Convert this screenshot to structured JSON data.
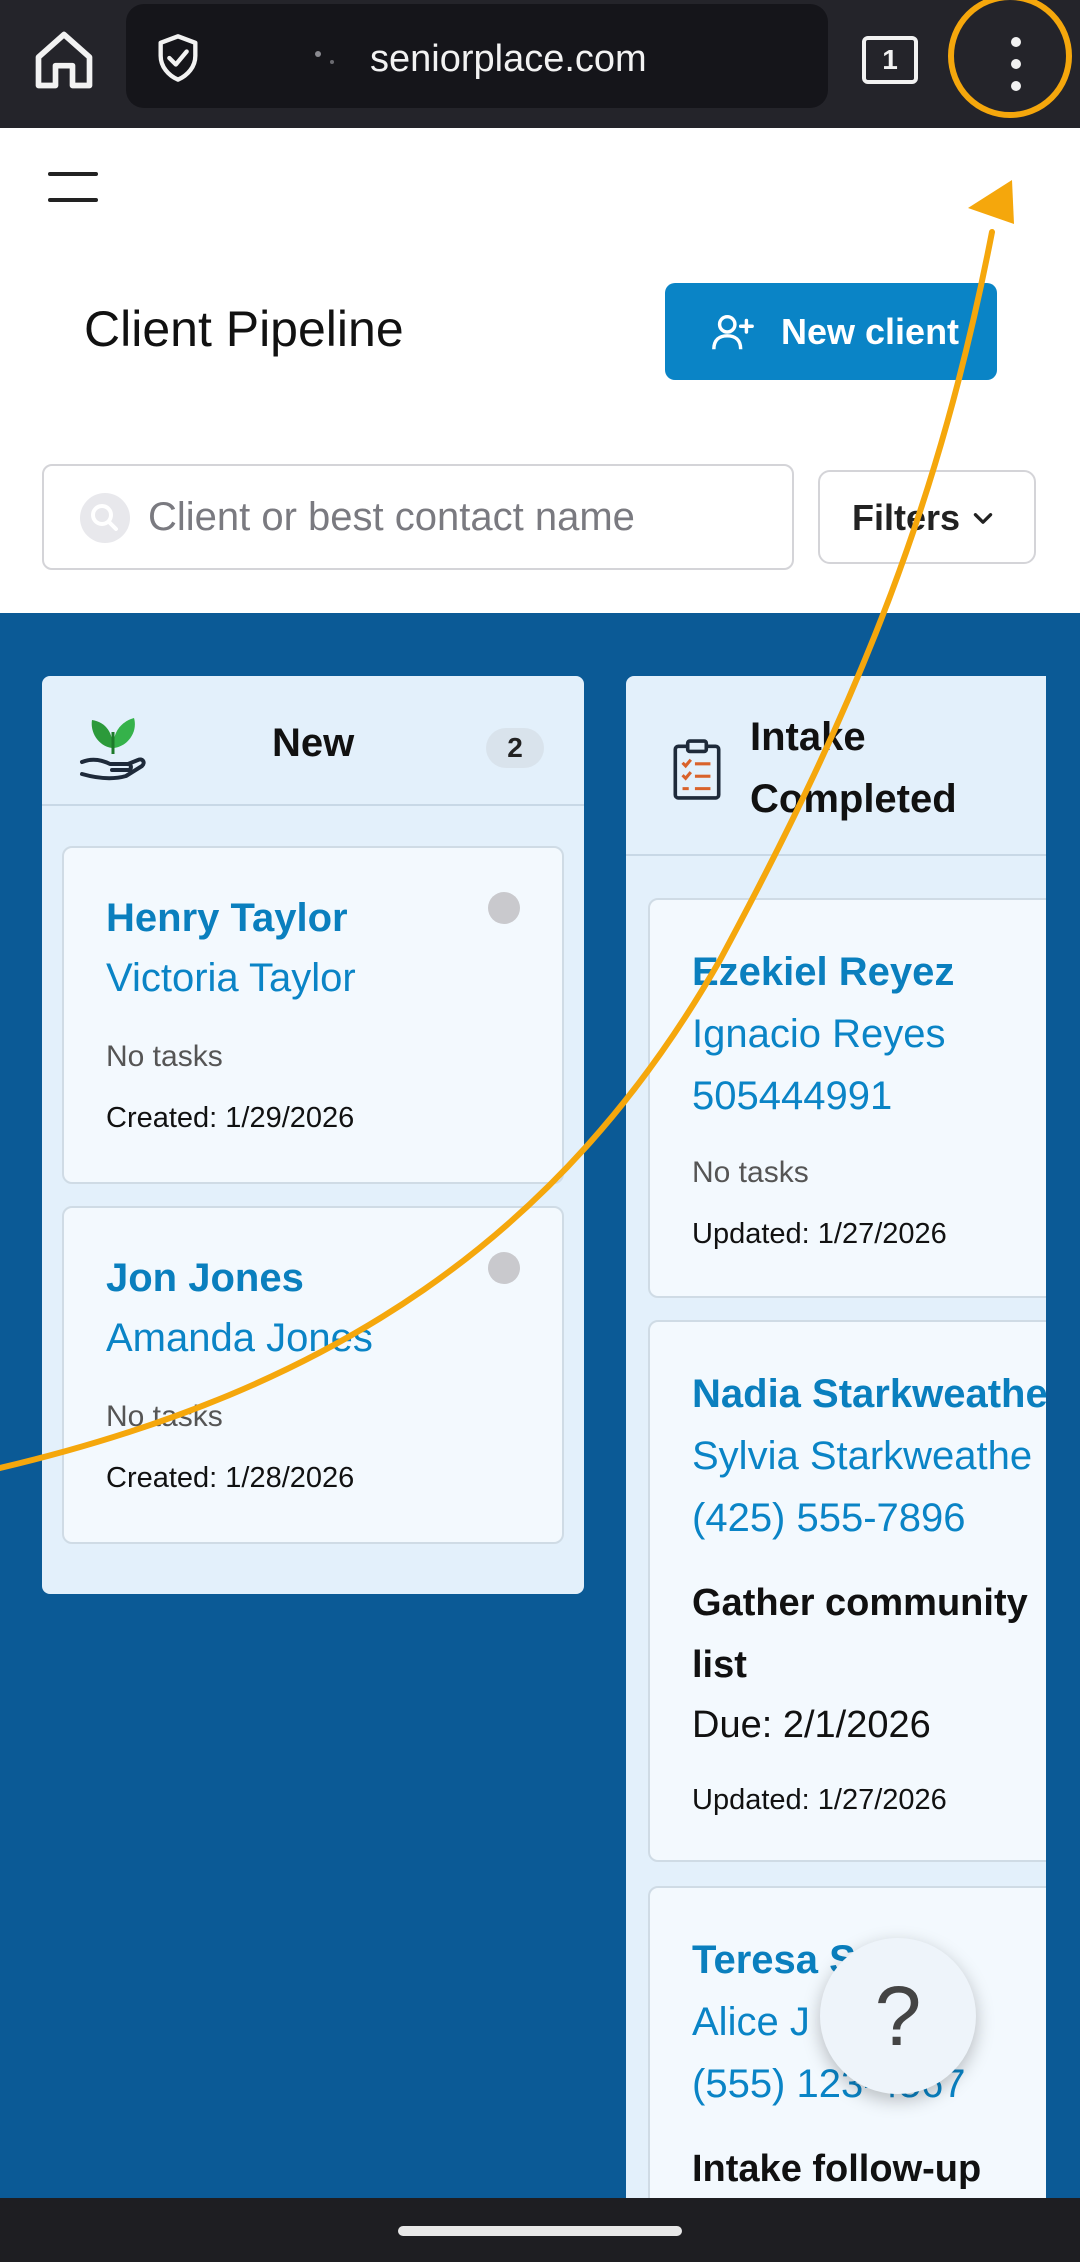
{
  "browser": {
    "url": "seniorplace.com",
    "tab_count": "1"
  },
  "header": {
    "title": "Client Pipeline",
    "new_client_label": "New client",
    "search_placeholder": "Client or best contact name",
    "filters_label": "Filters"
  },
  "columns": [
    {
      "title": "New",
      "count": "2",
      "cards": [
        {
          "name": "Henry Taylor",
          "contact": "Victoria Taylor",
          "tasks": "No tasks",
          "stamp": "Created: 1/29/2026"
        },
        {
          "name": "Jon Jones",
          "contact": "Amanda Jones",
          "tasks": "No tasks",
          "stamp": "Created: 1/28/2026"
        }
      ]
    },
    {
      "title_line1": "Intake",
      "title_line2": "Completed",
      "cards": [
        {
          "name": "Ezekiel Reyez",
          "contact": "Ignacio Reyes",
          "phone": "505444991",
          "tasks": "No tasks",
          "stamp": "Updated: 1/27/2026"
        },
        {
          "name": "Nadia Starkweathe",
          "contact": "Sylvia Starkweathe",
          "phone": "(425) 555-7896",
          "task_line1": "Gather community",
          "task_line2": "list",
          "due": "Due: 2/1/2026",
          "stamp": "Updated: 1/27/2026"
        },
        {
          "name": "Teresa S",
          "contact": "Alice J",
          "phone": "(555) 123-4567",
          "task_line1": "Intake follow-up"
        }
      ]
    }
  ],
  "help": {
    "label": "?"
  },
  "colors": {
    "accent": "#0a84c6",
    "board": "#0b5a96",
    "annotation": "#f5a70c"
  }
}
